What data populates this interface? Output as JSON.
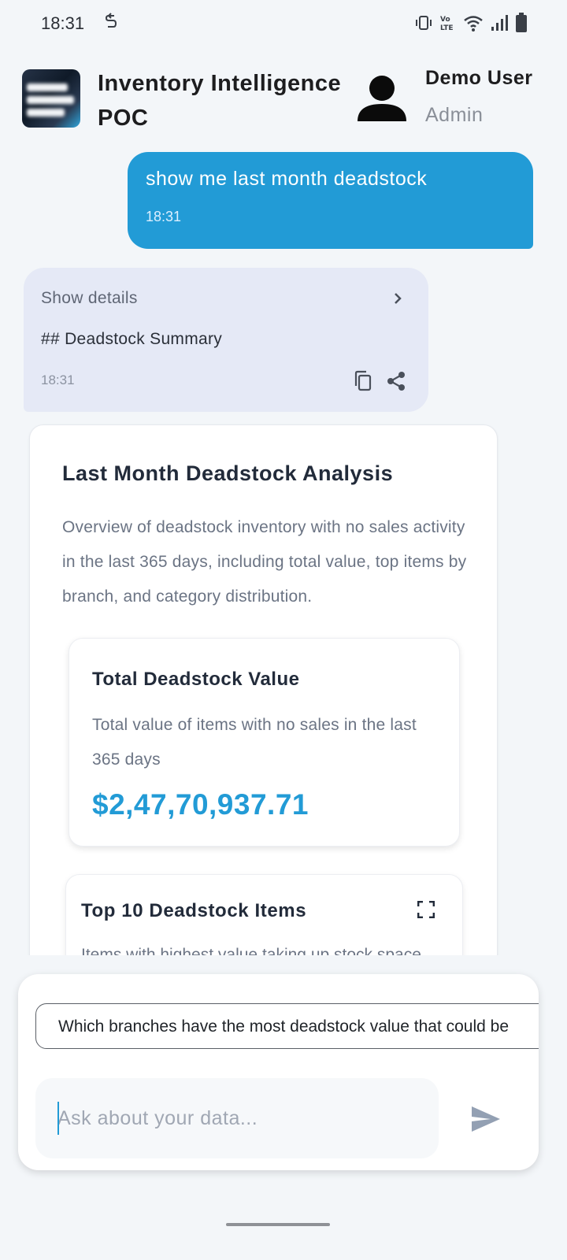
{
  "status_bar": {
    "time": "18:31"
  },
  "header": {
    "app_title": "Inventory Intelligence POC",
    "user_name": "Demo User",
    "user_role": "Admin"
  },
  "chat": {
    "user_message": {
      "text": "show me last month deadstock",
      "time": "18:31"
    },
    "assistant_message": {
      "details_label": "Show details",
      "text": "## Deadstock Summary",
      "time": "18:31"
    }
  },
  "analysis": {
    "title": "Last Month Deadstock Analysis",
    "description": "Overview of deadstock inventory with no sales activity in the last 365 days, including total value, top items by branch, and category distribution.",
    "total_card": {
      "title": "Total Deadstock Value",
      "description": "Total value of items with no sales in the last 365 days",
      "value": "$2,47,70,937.71"
    },
    "top_items_card": {
      "title": "Top 10 Deadstock Items",
      "description": "Items with highest value taking up stock space"
    }
  },
  "composer": {
    "suggestion": "Which branches have the most deadstock value that could be",
    "input_value": "",
    "placeholder": "Ask about your data..."
  },
  "colors": {
    "accent": "#229bd6",
    "assistant_bubble": "#e5e9f6",
    "background": "#f3f6f9"
  }
}
